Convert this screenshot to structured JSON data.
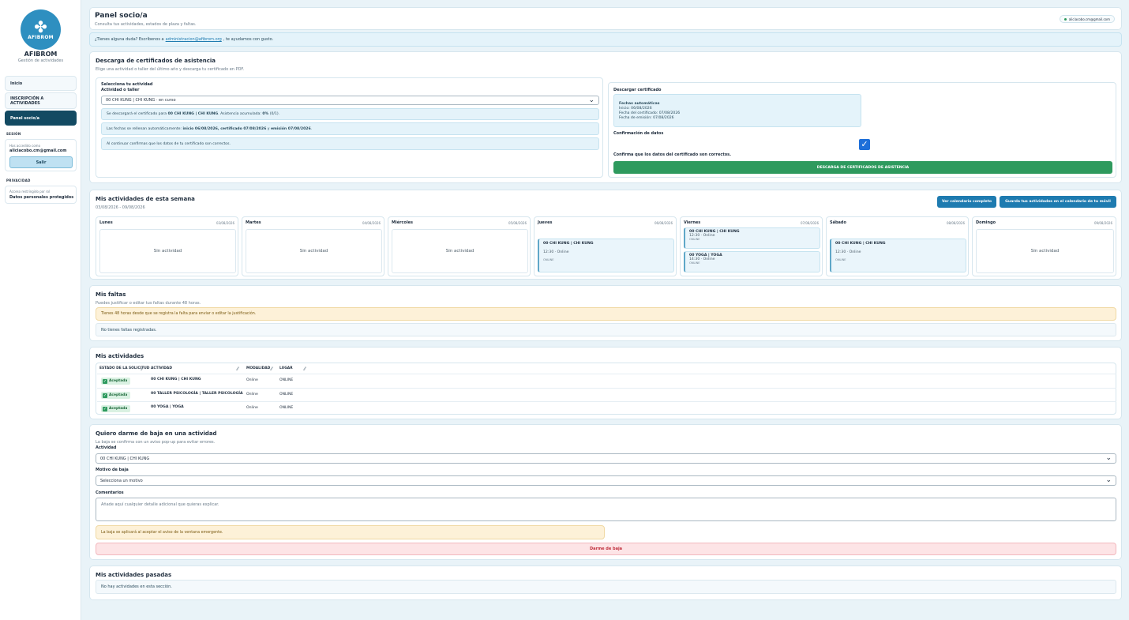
{
  "sidebar": {
    "logo_text": "AFIBROM",
    "brand": "AFIBROM",
    "brand_sub": "Gestión de actividades",
    "nav": [
      "Inicio",
      "INSCRIPCIÓN A ACTIVIDADES",
      "Panel socio/a"
    ],
    "session_label": "SESIÓN",
    "session_hint": "Has accedido como",
    "session_email": "aliciacobo.cm@gmail.com",
    "logout": "Salir",
    "privacy_label": "PRIVACIDAD",
    "privacy_hint": "Acceso restringido por rol",
    "privacy_text": "Datos personales protegidos"
  },
  "header": {
    "title": "Panel socio/a",
    "subtitle": "Consulta tus actividades, estados de plaza y faltas.",
    "user_email": "aliciacobo.cm@gmail.com"
  },
  "help": {
    "before": "¿Tienes alguna duda? Escríbenos a",
    "email": "administracion@afibrom.org",
    "after": ", te ayudamos con gusto."
  },
  "certificates": {
    "title": "Descarga de certificados de asistencia",
    "subtitle": "Elige una actividad o taller del último año y descarga tu certificado en PDF.",
    "select_title": "Selecciona tu actividad",
    "activity_label": "Actividad o taller",
    "activity_value": "00 CHI KUNG | CHI KUNG · en curso",
    "note1_pre": "Se descargará el certificado para",
    "note1_bold": "00 CHI KUNG | CHI KUNG",
    "note1_mid": ". Asistencia acumulada:",
    "note1_pct": "0%",
    "note1_post": "(0/1).",
    "note2_pre": "Las fechas se rellenan automáticamente:",
    "note2_bold": "inicio 06/08/2026, certificado 07/08/2026",
    "note2_mid": "y",
    "note2_bold2": "emisión 07/08/2026",
    "note2_post": ".",
    "note3": "Al continuar confirmas que los datos de tu certificado son correctos.",
    "download_title": "Descargar certificado",
    "auto_title": "Fechas automáticas",
    "auto_start": "Inicio: 06/08/2026",
    "auto_cert": "Fecha del certificado: 07/08/2026",
    "auto_emit": "Fecha de emisión: 07/08/2026",
    "confirm_title": "Confirmación de datos",
    "confirm_text": "Confirma que los datos del certificado son correctos.",
    "confirm_checked": true,
    "download_button": "DESCARGA DE CERTIFICADOS DE ASISTENCIA"
  },
  "week": {
    "title": "Mis actividades de esta semana",
    "range": "03/08/2026 - 09/08/2026",
    "btn_calendar": "Ver calendario completo",
    "btn_save": "Guarda tus actividades en el calendario de tu móvil",
    "empty": "Sin actividad",
    "days": [
      {
        "name": "Lunes",
        "date": "03/08/2026"
      },
      {
        "name": "Martes",
        "date": "04/08/2026"
      },
      {
        "name": "Miércoles",
        "date": "05/08/2026"
      },
      {
        "name": "Jueves",
        "date": "06/08/2026"
      },
      {
        "name": "Viernes",
        "date": "07/08/2026"
      },
      {
        "name": "Sábado",
        "date": "08/08/2026"
      },
      {
        "name": "Domingo",
        "date": "09/08/2026"
      }
    ],
    "events": {
      "thu": [
        {
          "title": "00 CHI KUNG | CHI KUNG",
          "meta": "12:30 · Online",
          "place": "ONLINE"
        }
      ],
      "fri": [
        {
          "title": "00 CHI KUNG | CHI KUNG",
          "meta": "12:30 · Online",
          "place": "ONLINE"
        },
        {
          "title": "00 YOGA | YOGA",
          "meta": "14:30 · Online",
          "place": "ONLINE"
        }
      ],
      "sat": [
        {
          "title": "00 CHI KUNG | CHI KUNG",
          "meta": "12:30 · Online",
          "place": "ONLINE"
        }
      ]
    }
  },
  "absences": {
    "title": "Mis faltas",
    "subtitle": "Puedes justificar o editar tus faltas durante 48 horas.",
    "warning": "Tienes 48 horas desde que se registra la falta para enviar o editar la justificación.",
    "empty": "No tienes faltas registradas."
  },
  "activities": {
    "title": "Mis actividades",
    "columns": [
      "ESTADO DE LA SOLICITUD",
      "ACTIVIDAD",
      "MODALIDAD",
      "LUGAR"
    ],
    "rows": [
      {
        "status": "Aceptada",
        "activity": "00 CHI KUNG | CHI KUNG",
        "mode": "Online",
        "place": "ONLINE"
      },
      {
        "status": "Aceptada",
        "activity": "00 TALLER PSICOLOGÍA | TALLER PSICOLOGÍA",
        "mode": "Online",
        "place": "ONLINE"
      },
      {
        "status": "Aceptada",
        "activity": "00 YOGA | YOGA",
        "mode": "Online",
        "place": "ONLINE"
      }
    ]
  },
  "unsubscribe": {
    "title": "Quiero darme de baja en una actividad",
    "subtitle": "La baja se confirma con un aviso pop-up para evitar errores.",
    "activity_label": "Actividad",
    "activity_value": "00 CHI KUNG | CHI KUNG",
    "reason_label": "Motivo de baja",
    "reason_value": "Selecciona un motivo",
    "comments_label": "Comentarios",
    "comments_placeholder": "Añade aquí cualquier detalle adicional que quieras explicar.",
    "warning": "La baja se aplicará al aceptar el aviso de la ventana emergente.",
    "button": "Darme de baja"
  },
  "past": {
    "title": "Mis actividades pasadas",
    "empty": "No hay actividades en esta sección."
  },
  "colors": {
    "primary_dark": "#134a62",
    "accent_blue": "#1e7bb0",
    "success": "#2e9a5e",
    "danger": "#c0303d"
  }
}
